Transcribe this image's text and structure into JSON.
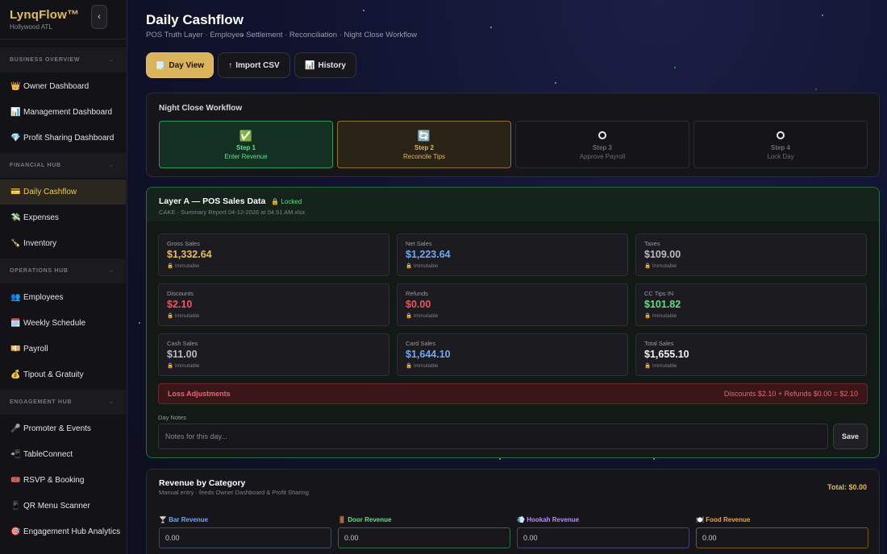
{
  "brand": {
    "name": "LynqFlow™",
    "location": "Hollywood ATL",
    "collapse": "‹"
  },
  "sidebar": {
    "sections": [
      {
        "title": "BUSINESS OVERVIEW",
        "items": [
          {
            "icon": "👑",
            "label": "Owner Dashboard"
          },
          {
            "icon": "📊",
            "label": "Management Dashboard"
          },
          {
            "icon": "💎",
            "label": "Profit Sharing Dashboard"
          }
        ]
      },
      {
        "title": "FINANCIAL HUB",
        "items": [
          {
            "icon": "💳",
            "label": "Daily Cashflow",
            "active": true
          },
          {
            "icon": "💸",
            "label": "Expenses"
          },
          {
            "icon": "🍾",
            "label": "Inventory"
          }
        ]
      },
      {
        "title": "OPERATIONS HUB",
        "items": [
          {
            "icon": "👥",
            "label": "Employees"
          },
          {
            "icon": "🗓️",
            "label": "Weekly Schedule"
          },
          {
            "icon": "💴",
            "label": "Payroll"
          },
          {
            "icon": "💰",
            "label": "Tipout & Gratuity"
          }
        ]
      },
      {
        "title": "ENGAGEMENT HUB",
        "items": [
          {
            "icon": "🎤",
            "label": "Promoter & Events"
          },
          {
            "icon": "📲",
            "label": "TableConnect"
          },
          {
            "icon": "🎟️",
            "label": "RSVP & Booking"
          },
          {
            "icon": "📱",
            "label": "QR Menu Scanner"
          },
          {
            "icon": "🎯",
            "label": "Engagement Hub Analytics"
          }
        ]
      }
    ],
    "chevron": "⌄"
  },
  "header": {
    "title": "Daily Cashflow",
    "subtitle": "POS Truth Layer · Employee Settlement · Reconciliation · Night Close Workflow"
  },
  "tabs": [
    {
      "icon": "🗒️",
      "label": "Day View",
      "active": true
    },
    {
      "icon": "↑",
      "label": "Import CSV"
    },
    {
      "icon": "📊",
      "label": "History"
    }
  ],
  "workflow": {
    "title": "Night Close Workflow",
    "steps": [
      {
        "icon": "✅",
        "num": "Step 1",
        "label": "Enter Revenue",
        "state": "done"
      },
      {
        "icon": "🔄",
        "num": "Step 2",
        "label": "Reconcile Tips",
        "state": "current"
      },
      {
        "icon": "○",
        "num": "Step 3",
        "label": "Approve Payroll",
        "state": "pending"
      },
      {
        "icon": "○",
        "num": "Step 4",
        "label": "Lock Day",
        "state": "pending"
      }
    ]
  },
  "pos": {
    "title": "Layer A — POS Sales Data",
    "lock_icon": "🔒",
    "lock_label": "Locked",
    "source": "CAKE · Summary Report 04-12-2026 at 04.51 AM.xlsx",
    "immutable_label": "Immutable",
    "metrics": [
      {
        "label": "Gross Sales",
        "value": "$1,332.64",
        "color": "gold"
      },
      {
        "label": "Net Sales",
        "value": "$1,223.64",
        "color": "blue"
      },
      {
        "label": "Taxes",
        "value": "$109.00",
        "color": "grey"
      },
      {
        "label": "Discounts",
        "value": "$2.10",
        "color": "red"
      },
      {
        "label": "Refunds",
        "value": "$0.00",
        "color": "red"
      },
      {
        "label": "CC Tips IN",
        "value": "$101.82",
        "color": "green"
      },
      {
        "label": "Cash Sales",
        "value": "$11.00",
        "color": "grey"
      },
      {
        "label": "Card Sales",
        "value": "$1,644.10",
        "color": "blue"
      },
      {
        "label": "Total Sales",
        "value": "$1,655.10",
        "color": "white"
      }
    ],
    "loss": {
      "label": "Loss Adjustments",
      "summary": "Discounts $2.10 + Refunds $0.00 = $2.10"
    },
    "notes": {
      "label": "Day Notes",
      "placeholder": "Notes for this day...",
      "value": ""
    },
    "save_label": "Save"
  },
  "revenue": {
    "title": "Revenue by Category",
    "subtitle": "Manual entry · feeds Owner Dashboard & Profit Sharing",
    "total": "Total: $0.00",
    "fields": [
      {
        "icon": "🍸",
        "label": "Bar Revenue",
        "placeholder": "0.00",
        "color": "#6fa8f5",
        "border": "#3d4a66"
      },
      {
        "icon": "🚪",
        "label": "Door Revenue",
        "placeholder": "0.00",
        "color": "#5fe07f",
        "border": "#2f6a45"
      },
      {
        "icon": "💨",
        "label": "Hookah Revenue",
        "placeholder": "0.00",
        "color": "#b98cf7",
        "border": "#4f3f72"
      },
      {
        "icon": "🍽️",
        "label": "Food Revenue",
        "placeholder": "0.00",
        "color": "#f0a33e",
        "border": "#7a5522"
      }
    ]
  },
  "colors": {
    "accent": "#d9b45a",
    "success": "#2e9a5b",
    "danger": "#ee5560",
    "info": "#6fa8f5"
  }
}
